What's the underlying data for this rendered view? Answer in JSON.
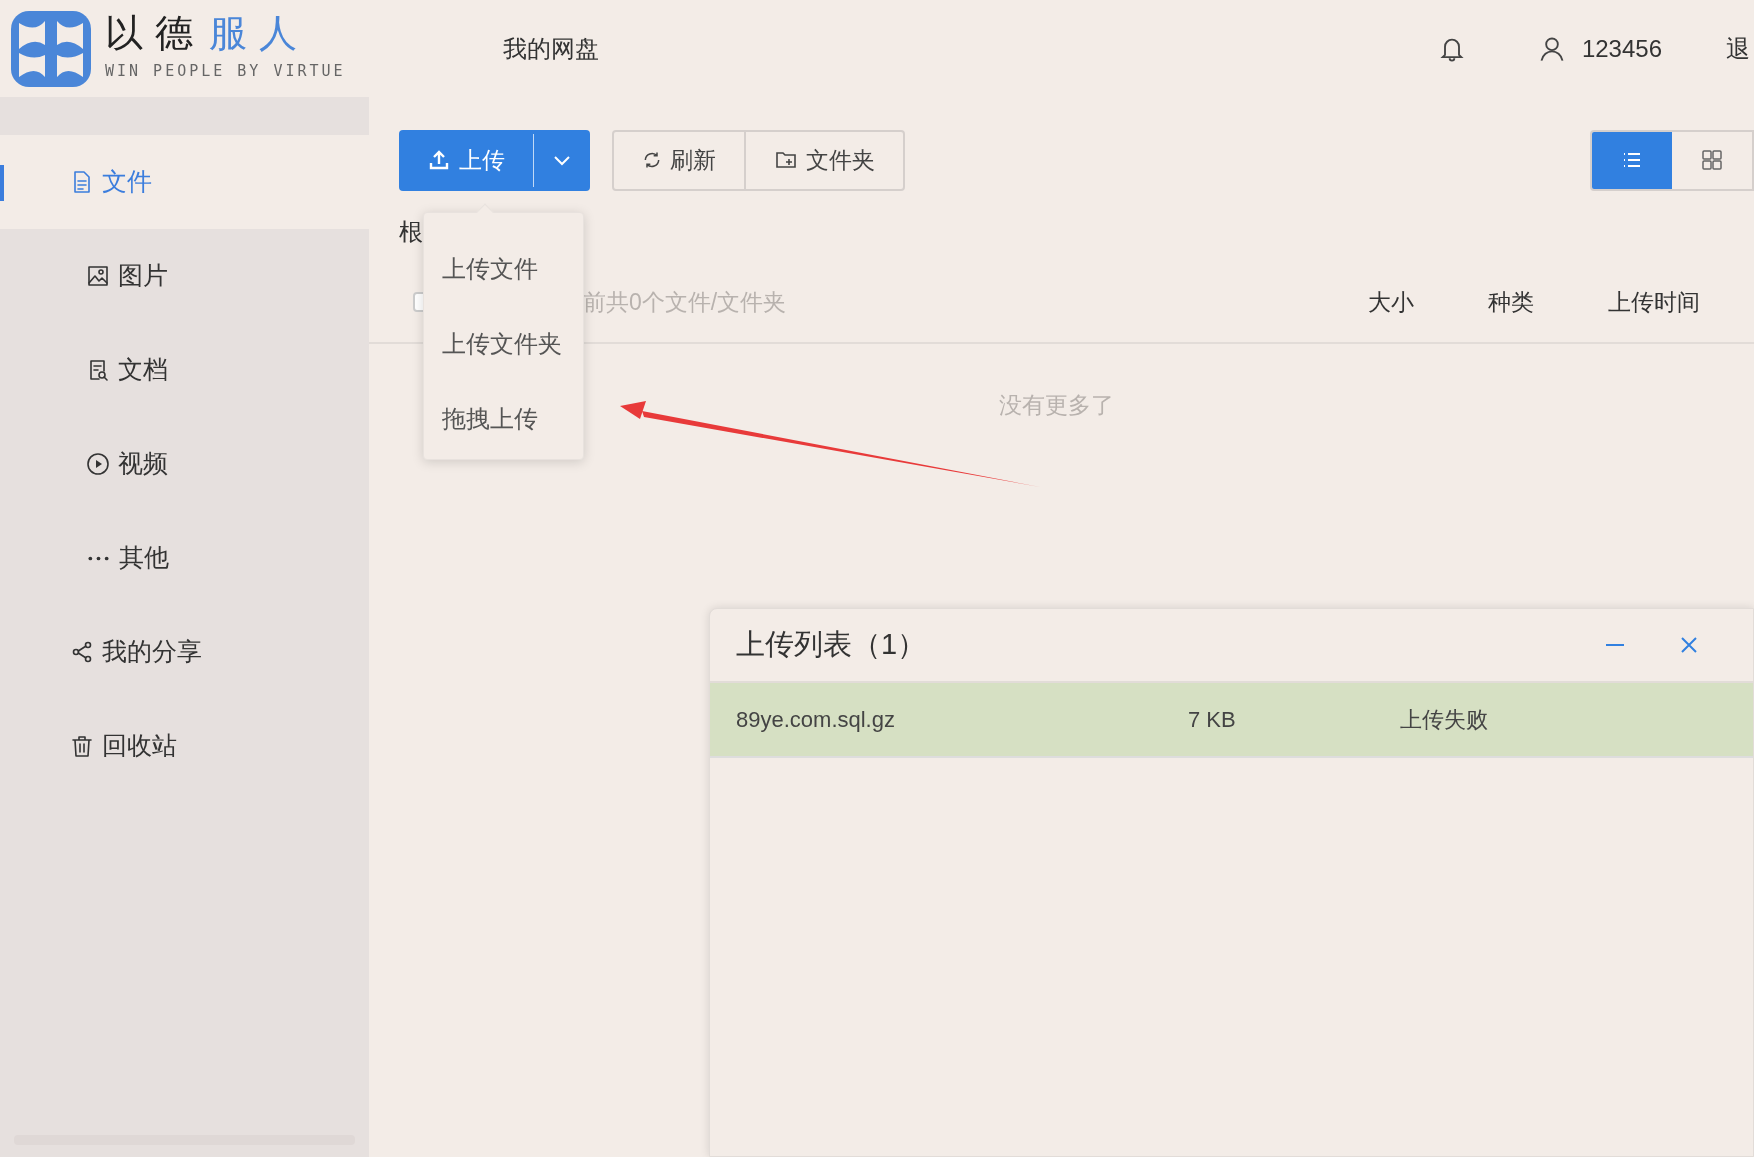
{
  "logo": {
    "title_dark": "以 德",
    "title_blue": "服 人",
    "subtitle": "WIN PEOPLE BY VIRTUE"
  },
  "header": {
    "nav": "我的网盘",
    "user": "123456",
    "logout": "退"
  },
  "sidebar": {
    "items": [
      {
        "label": "文件",
        "kind": "file",
        "selected": true
      },
      {
        "label": "图片",
        "kind": "image",
        "selected": false
      },
      {
        "label": "文档",
        "kind": "doc",
        "selected": false
      },
      {
        "label": "视频",
        "kind": "video",
        "selected": false
      },
      {
        "label": "其他",
        "kind": "more",
        "selected": false
      },
      {
        "label": "我的分享",
        "kind": "share",
        "selected": false
      },
      {
        "label": "回收站",
        "kind": "trash",
        "selected": false
      }
    ]
  },
  "toolbar": {
    "upload": "上传",
    "refresh": "刷新",
    "folder": "文件夹",
    "views": [
      {
        "kind": "list",
        "selected": true
      },
      {
        "kind": "grid",
        "selected": false
      }
    ]
  },
  "upload_menu": [
    "上传文件",
    "上传文件夹",
    "拖拽上传"
  ],
  "breadcrumb": "根",
  "table": {
    "checked": false,
    "summary": "前共0个文件/文件夹",
    "columns": [
      "大小",
      "种类",
      "上传时间"
    ],
    "empty": "没有更多了"
  },
  "upload_panel": {
    "title": "上传列表（1）",
    "rows": [
      {
        "name": "89ye.com.sql.gz",
        "size": "7 KB",
        "status": "上传失败"
      }
    ]
  }
}
